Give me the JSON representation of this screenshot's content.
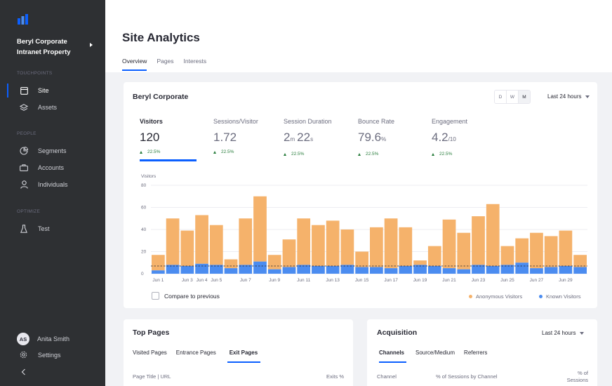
{
  "sidebar": {
    "property_name": "Beryl Corporate Intranet Property",
    "sections": [
      {
        "label": "TOUCHPOINTS"
      },
      {
        "label": "PEOPLE"
      },
      {
        "label": "OPTIMIZE"
      }
    ],
    "items": [
      {
        "label": "Site",
        "icon": "site-icon",
        "active": true
      },
      {
        "label": "Assets",
        "icon": "assets-icon"
      },
      {
        "label": "Segments",
        "icon": "segments-icon"
      },
      {
        "label": "Accounts",
        "icon": "accounts-icon"
      },
      {
        "label": "Individuals",
        "icon": "individuals-icon"
      },
      {
        "label": "Test",
        "icon": "test-icon"
      }
    ],
    "user": {
      "initials": "AS",
      "name": "Anita Smith"
    },
    "settings_label": "Settings",
    "collapse_icon": "chevron-left-icon"
  },
  "header": {
    "title": "Site Analytics",
    "tabs": [
      "Overview",
      "Pages",
      "Interests"
    ]
  },
  "overview": {
    "title": "Beryl Corporate",
    "period_buttons": [
      "D",
      "W",
      "M"
    ],
    "selected_period": "M",
    "range": "Last 24 hours",
    "metrics": [
      {
        "label": "Visitors",
        "value": "120",
        "delta": "22.5%"
      },
      {
        "label": "Sessions/Visitor",
        "value": "1.72",
        "delta": "22.5%"
      },
      {
        "label": "Session Duration",
        "value_parts": [
          "2",
          "m",
          "22",
          "s"
        ],
        "delta": "22.5%"
      },
      {
        "label": "Bounce Rate",
        "value_parts": [
          "79.6",
          "%"
        ],
        "delta": "22.5%"
      },
      {
        "label": "Engagement",
        "value_parts": [
          "4.2",
          "/10"
        ],
        "delta": "22.5%"
      }
    ],
    "compare_label": "Compare to previous",
    "legend": [
      "Anonymous Visitors",
      "Known Visitors"
    ]
  },
  "chart_data": {
    "type": "bar",
    "stacked": true,
    "ylabel": "Visitors",
    "ylim": [
      0,
      80
    ],
    "yticks": [
      0,
      20,
      40,
      60,
      80
    ],
    "x_tick_labels": [
      "Jun 1",
      "Jun 3",
      "Jun 4",
      "Jun 5",
      "Jun 7",
      "Jun 9",
      "Jun 11",
      "Jun 13",
      "Jun 15",
      "Jun 17",
      "Jun 19",
      "Jun 21",
      "Jun 23",
      "Jun 25",
      "Jun 27",
      "Jun 29"
    ],
    "average": 7,
    "colors": {
      "anonymous": "#f5b26b",
      "known": "#4b8cf0"
    },
    "series": [
      {
        "name": "Known Visitors",
        "values": [
          3,
          8,
          7,
          9,
          8,
          5,
          8,
          11,
          4,
          6,
          8,
          7,
          7,
          8,
          6,
          6,
          5,
          7,
          8,
          7,
          5,
          4,
          8,
          7,
          8,
          10,
          5,
          6,
          7,
          6,
          7,
          3
        ]
      },
      {
        "name": "Anonymous Visitors",
        "values": [
          14,
          42,
          32,
          44,
          36,
          8,
          42,
          59,
          13,
          25,
          42,
          37,
          41,
          32,
          14,
          36,
          45,
          35,
          4,
          18,
          44,
          33,
          44,
          56,
          17,
          22,
          32,
          28,
          32,
          11
        ]
      }
    ]
  },
  "top_pages": {
    "title": "Top Pages",
    "tabs": [
      "Visited Pages",
      "Entrance Pages",
      "Exit Pages"
    ],
    "active_tab": "Exit Pages",
    "columns": [
      "Page Title | URL",
      "Exits %"
    ]
  },
  "acquisition": {
    "title": "Acquisition",
    "range": "Last 24 hours",
    "tabs": [
      "Channels",
      "Source/Medium",
      "Referrers"
    ],
    "active_tab": "Channels",
    "columns": [
      "Channel",
      "% of Sessions by Channel",
      "% of Sessions"
    ]
  },
  "colors": {
    "accent": "#0b5fff",
    "positive": "#287d3c",
    "sidebar_bg": "#2e3033"
  }
}
